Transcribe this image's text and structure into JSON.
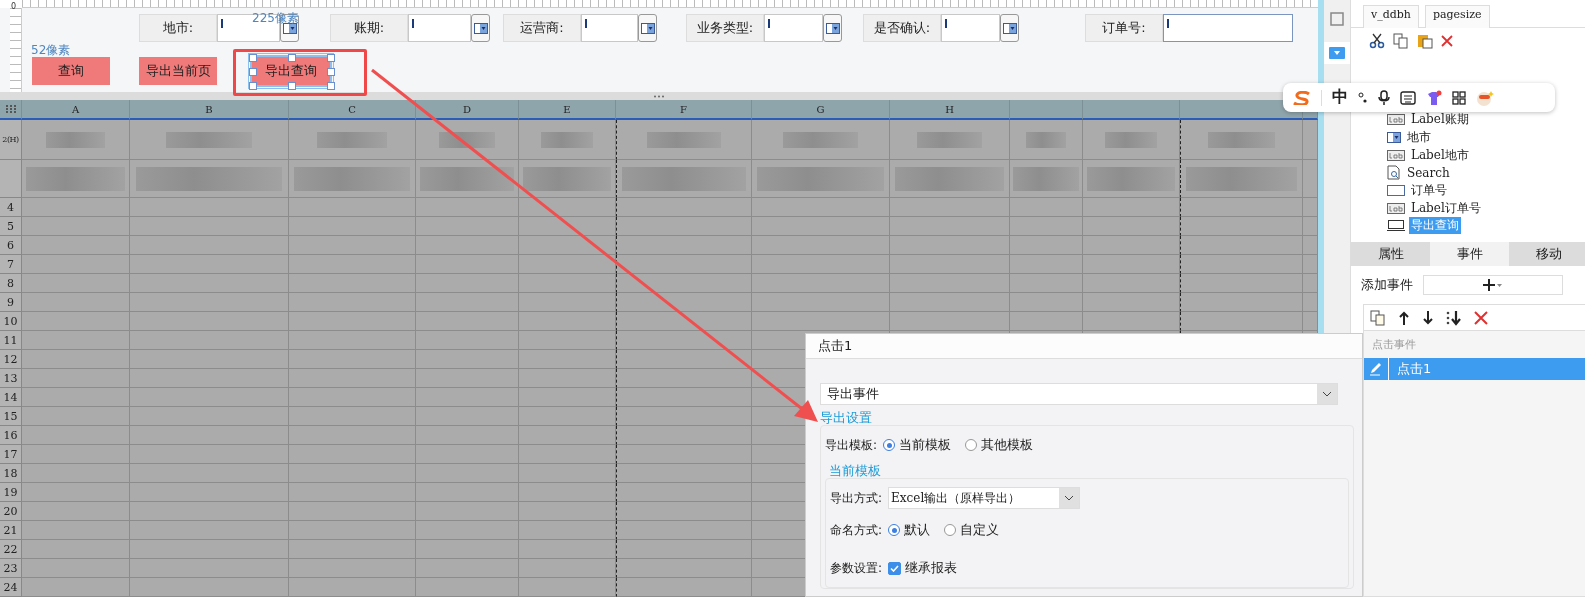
{
  "ruler": {
    "origin": "0"
  },
  "annotations": [
    {
      "kind": "width",
      "text": "225像素"
    },
    {
      "kind": "height",
      "text": "52像素"
    }
  ],
  "filters": [
    {
      "label": "地市:",
      "kind": "combo"
    },
    {
      "label": "账期:",
      "kind": "combo"
    },
    {
      "label": "运营商:",
      "kind": "combo"
    },
    {
      "label": "业务类型:",
      "kind": "combo"
    },
    {
      "label": "是否确认:",
      "kind": "combo"
    },
    {
      "label": "订单号:",
      "kind": "text"
    }
  ],
  "buttons": [
    {
      "label": "查询",
      "selected": false
    },
    {
      "label": "导出当前页",
      "selected": false
    },
    {
      "label": "导出查询",
      "selected": true
    }
  ],
  "sheet": {
    "columns": [
      "A",
      "B",
      "C",
      "D",
      "E",
      "F",
      "G",
      "H"
    ],
    "header_row": "2(H)",
    "row_numbers": [
      "4",
      "5",
      "6",
      "7",
      "8",
      "9",
      "10",
      "11",
      "12",
      "13",
      "14",
      "15",
      "16",
      "17",
      "18",
      "19",
      "20",
      "21",
      "22",
      "23",
      "24"
    ]
  },
  "side_tabs": [
    {
      "label": "v_ddbh"
    },
    {
      "label": "pagesize"
    }
  ],
  "tree": [
    {
      "label": "Label账期",
      "kind": "label",
      "selected": false
    },
    {
      "label": "地市",
      "kind": "combo",
      "selected": false
    },
    {
      "label": "Label地市",
      "kind": "label",
      "selected": false
    },
    {
      "label": "Search",
      "kind": "search",
      "selected": false
    },
    {
      "label": "订单号",
      "kind": "text",
      "selected": false
    },
    {
      "label": "Label订单号",
      "kind": "label",
      "selected": false
    },
    {
      "label": "导出查询",
      "kind": "button",
      "selected": true
    }
  ],
  "panel_tabs": [
    {
      "label": "属性",
      "selected": false
    },
    {
      "label": "事件",
      "selected": true
    },
    {
      "label": "移动",
      "selected": false
    }
  ],
  "add_event": {
    "label": "添加事件"
  },
  "events": {
    "header": "点击事件",
    "items": [
      {
        "label": "点击1",
        "selected": true
      }
    ]
  },
  "ime": {
    "mode": "中"
  },
  "dialog": {
    "title": "点击1",
    "event_type": "导出事件",
    "export_settings": {
      "legend": "导出设置",
      "template_label": "导出模板:",
      "template_options": [
        {
          "label": "当前模板",
          "selected": true
        },
        {
          "label": "其他模板",
          "selected": false
        }
      ]
    },
    "current_template": {
      "legend": "当前模板",
      "method_label": "导出方式:",
      "method_value": "Excel输出（原样导出）",
      "naming_label": "命名方式:",
      "naming_options": [
        {
          "label": "默认",
          "selected": true
        },
        {
          "label": "自定义",
          "selected": false
        }
      ],
      "param_label": "参数设置:",
      "inherit": {
        "label": "继承报表",
        "checked": true
      }
    }
  }
}
